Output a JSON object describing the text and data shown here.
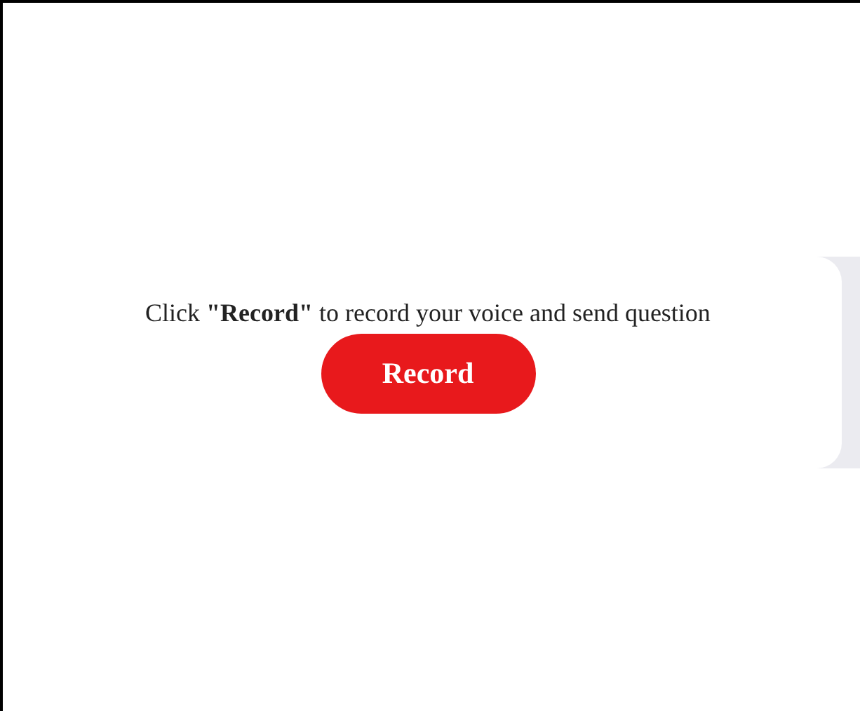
{
  "prompt": "Click **\"Record\"** to record your voice and send question",
  "button": {
    "label": "Record"
  }
}
